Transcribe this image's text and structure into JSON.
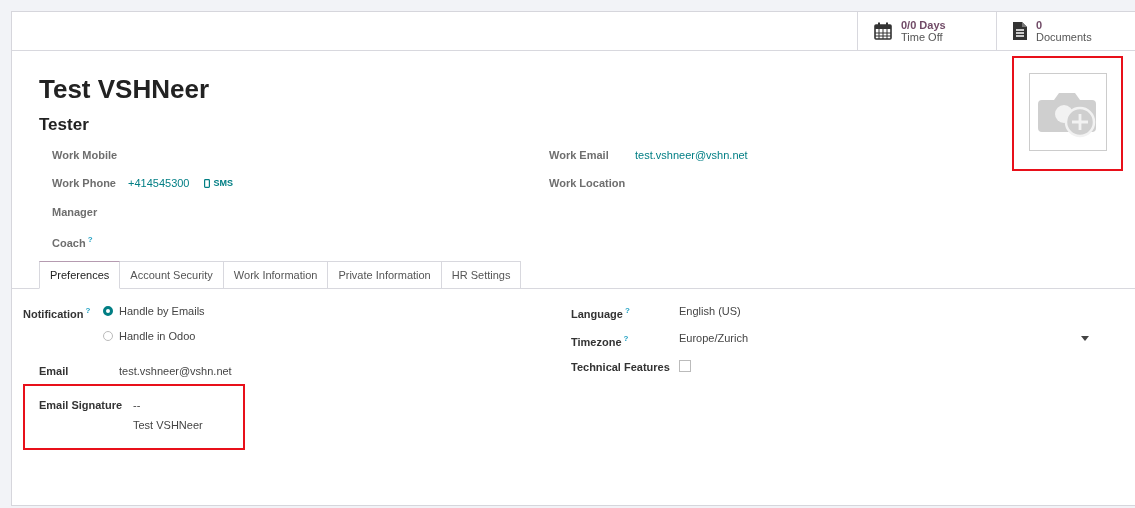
{
  "stat_buttons": [
    {
      "kind": "calendar",
      "value": "0/0 Days",
      "label": "Time Off"
    },
    {
      "kind": "document",
      "value": "0",
      "label": "Documents"
    }
  ],
  "employee": {
    "name": "Test VSHNeer",
    "job_title": "Tester"
  },
  "photo": {
    "highlighted": true
  },
  "fields_left": [
    {
      "label": "Work Mobile"
    },
    {
      "label": "Work Phone",
      "value": "+414545300",
      "action": "SMS"
    },
    {
      "label": "Manager"
    },
    {
      "label": "Coach",
      "help": "?"
    }
  ],
  "fields_right": [
    {
      "label": "Work Email",
      "value": "test.vshneer@vshn.net"
    },
    {
      "label": "Work Location"
    }
  ],
  "tabs": [
    {
      "label": "Preferences",
      "selected": true
    },
    {
      "label": "Account Security",
      "selected": false
    },
    {
      "label": "Work Information",
      "selected": false
    },
    {
      "label": "Private Information",
      "selected": false
    },
    {
      "label": "HR Settings",
      "selected": false
    }
  ],
  "preferences": {
    "notification": {
      "label": "Notification",
      "help": "?",
      "options": [
        {
          "label": "Handle by Emails",
          "selected": true
        },
        {
          "label": "Handle in Odoo",
          "selected": false
        }
      ]
    },
    "email": {
      "label": "Email",
      "value": "test.vshneer@vshn.net"
    },
    "email_signature": {
      "label": "Email Signature",
      "lines": [
        "--",
        "Test VSHNeer"
      ],
      "highlighted": true
    },
    "language": {
      "label": "Language",
      "help": "?",
      "value": "English (US)"
    },
    "timezone": {
      "label": "Timezone",
      "help": "?",
      "value": "Europe/Zurich"
    },
    "technical_features": {
      "label": "Technical Features",
      "checked": false
    }
  }
}
